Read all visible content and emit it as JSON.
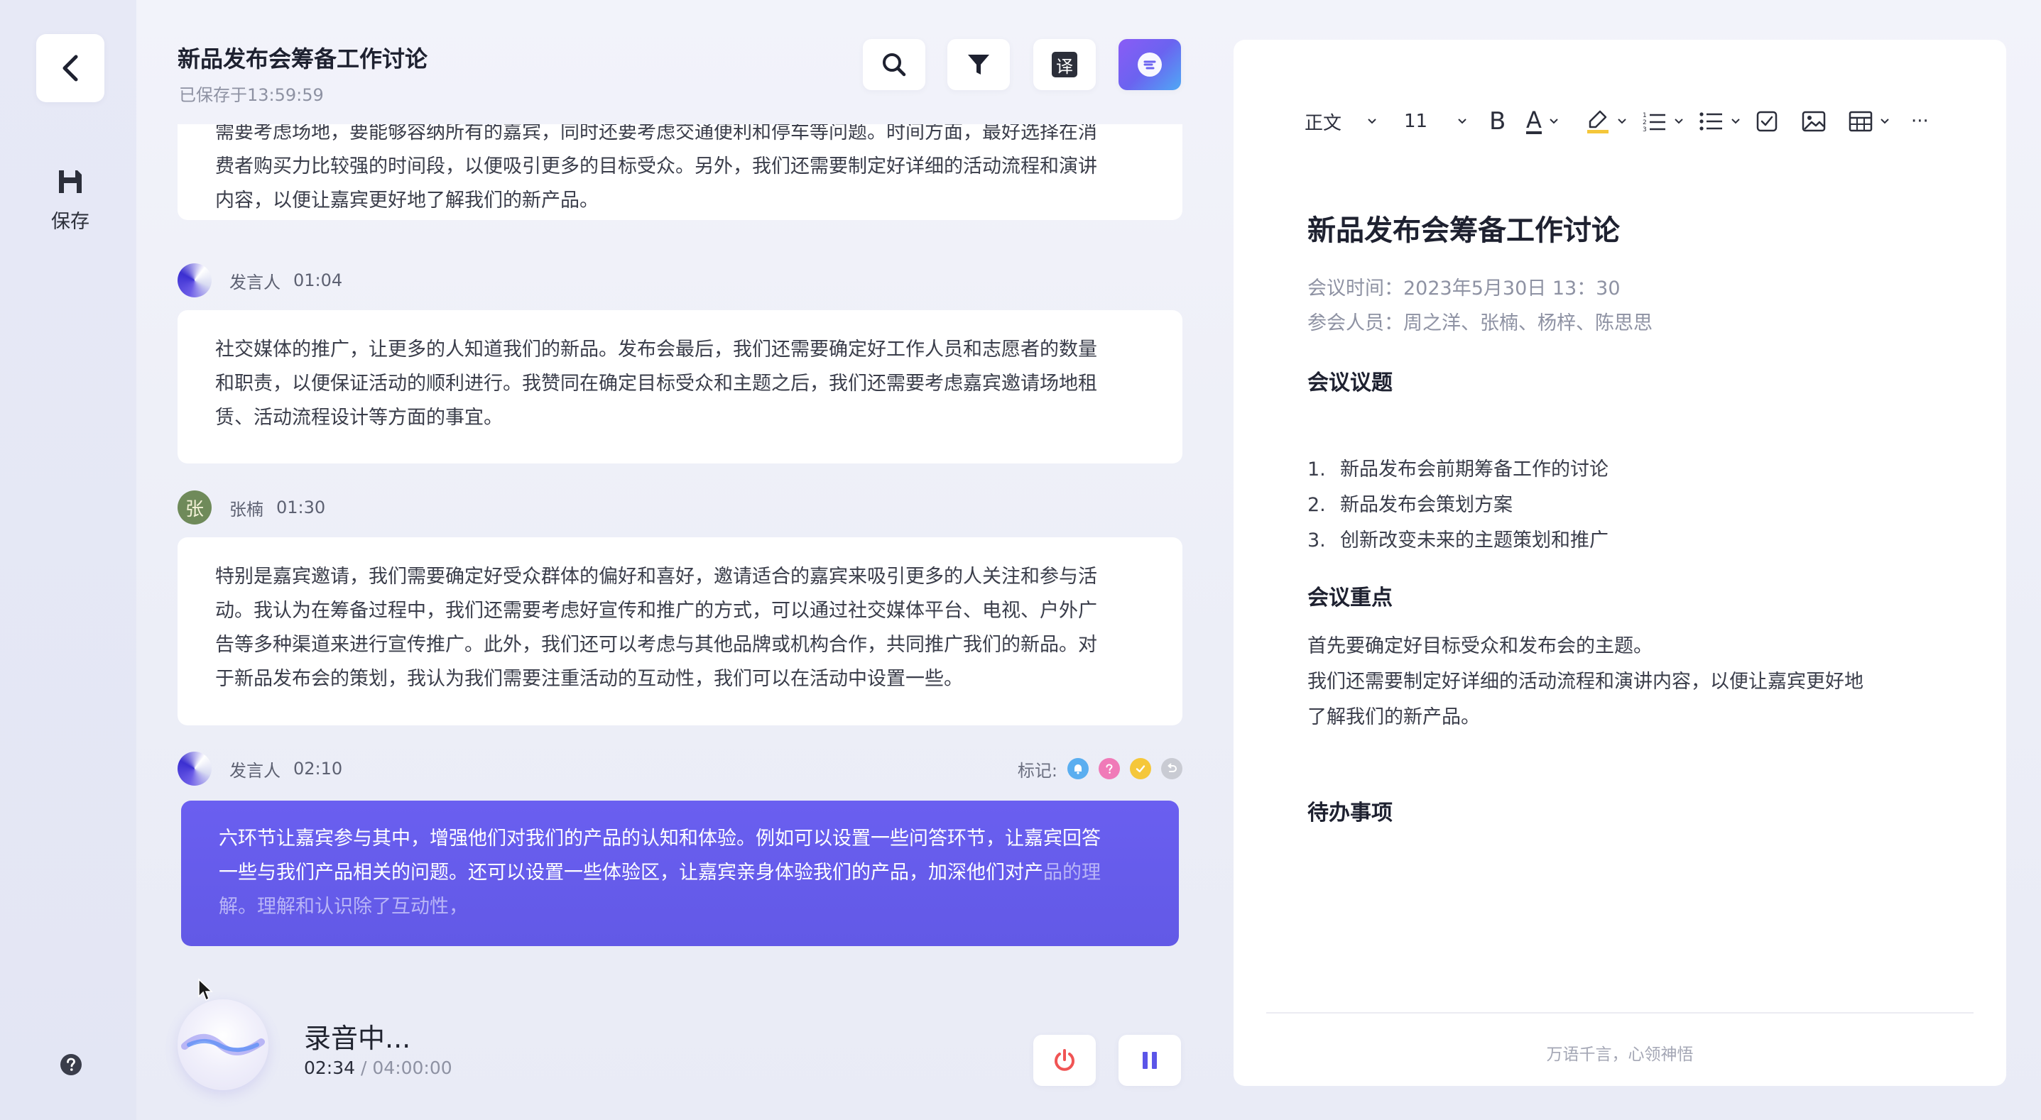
{
  "rail": {
    "save_label": "保存"
  },
  "header": {
    "title": "新品发布会筹备工作讨论",
    "saved_status": "已保存于13:59:59",
    "translate_glyph": "译"
  },
  "transcript": {
    "first_card": {
      "lines": [
        "需要考虑场地，要能够容纳所有的嘉宾，同时还要考虑交通便利和停车等问题。时间方面，最好选择在消",
        "费者购买力比较强的时间段，以便吸引更多的目标受众。另外，我们还需要制定好详细的活动流程和演讲",
        "内容，以便让嘉宾更好地了解我们的新产品。"
      ]
    },
    "blocks": [
      {
        "speaker": "发言人",
        "time": "01:04",
        "lines": [
          "社交媒体的推广，让更多的人知道我们的新品。发布会最后，我们还需要确定好工作人员和志愿者的数量",
          "和职责，以便保证活动的顺利进行。我赞同在确定目标受众和主题之后，我们还需要考虑嘉宾邀请场地租",
          "赁、活动流程设计等方面的事宜。"
        ]
      },
      {
        "speaker": "张楠",
        "avatar_glyph": "张",
        "time": "01:30",
        "lines": [
          "特别是嘉宾邀请，我们需要确定好受众群体的偏好和喜好，邀请适合的嘉宾来吸引更多的人关注和参与活",
          "动。我认为在筹备过程中，我们还需要考虑好宣传和推广的方式，可以通过社交媒体平台、电视、户外广",
          "告等多种渠道来进行宣传推广。此外，我们还可以考虑与其他品牌或机构合作，共同推广我们的新品。对",
          "于新品发布会的策划，我认为我们需要注重活动的互动性，我们可以在活动中设置一些。"
        ]
      },
      {
        "speaker": "发言人",
        "time": "02:10",
        "marks_label": "标记:",
        "lines_solid": [
          "六环节让嘉宾参与其中，增强他们对我们的产品的认知和体验。例如可以设置一些问答环节，让嘉宾回答",
          "一些与我们产品相关的问题。还可以设置一些体验区，让嘉宾亲身体验我们的产品，加深他们对产"
        ],
        "line2_fade": "品的理",
        "line3_fade": "解。理解和认识除了互动性，"
      }
    ]
  },
  "recording": {
    "status": "录音中...",
    "elapsed": "02:34",
    "separator": "/",
    "total": "04:00:00"
  },
  "editor": {
    "toolbar": {
      "style": "正文",
      "size": "11",
      "bold": "B",
      "font_color": "A",
      "more": "···"
    },
    "doc_title": "新品发布会筹备工作讨论",
    "meeting_time": "会议时间：2023年5月30日 13：30",
    "attendees": "参会人员：周之洋、张楠、杨梓、陈思思",
    "agenda_heading": "会议议题",
    "agenda": [
      {
        "num": "1.",
        "text": "新品发布会前期筹备工作的讨论"
      },
      {
        "num": "2.",
        "text": "新品发布会策划方案"
      },
      {
        "num": "3.",
        "text": "创新改变未来的主题策划和推广"
      }
    ],
    "key_heading": "会议重点",
    "key_lines": [
      "首先要确定好目标受众和发布会的主题。",
      "我们还需要制定好详细的活动流程和演讲内容，以便让嘉宾更好地",
      "了解我们的新产品。"
    ],
    "todo_heading": "待办事项",
    "footer": "万语千言，心领神悟"
  },
  "colors": {
    "accent": "#6259e6",
    "mark_blue": "#5aaef0",
    "mark_pink": "#f07ab8",
    "mark_yellow": "#f5c73a",
    "mark_grey": "#c9cbd3",
    "stop_red": "#f05454"
  }
}
